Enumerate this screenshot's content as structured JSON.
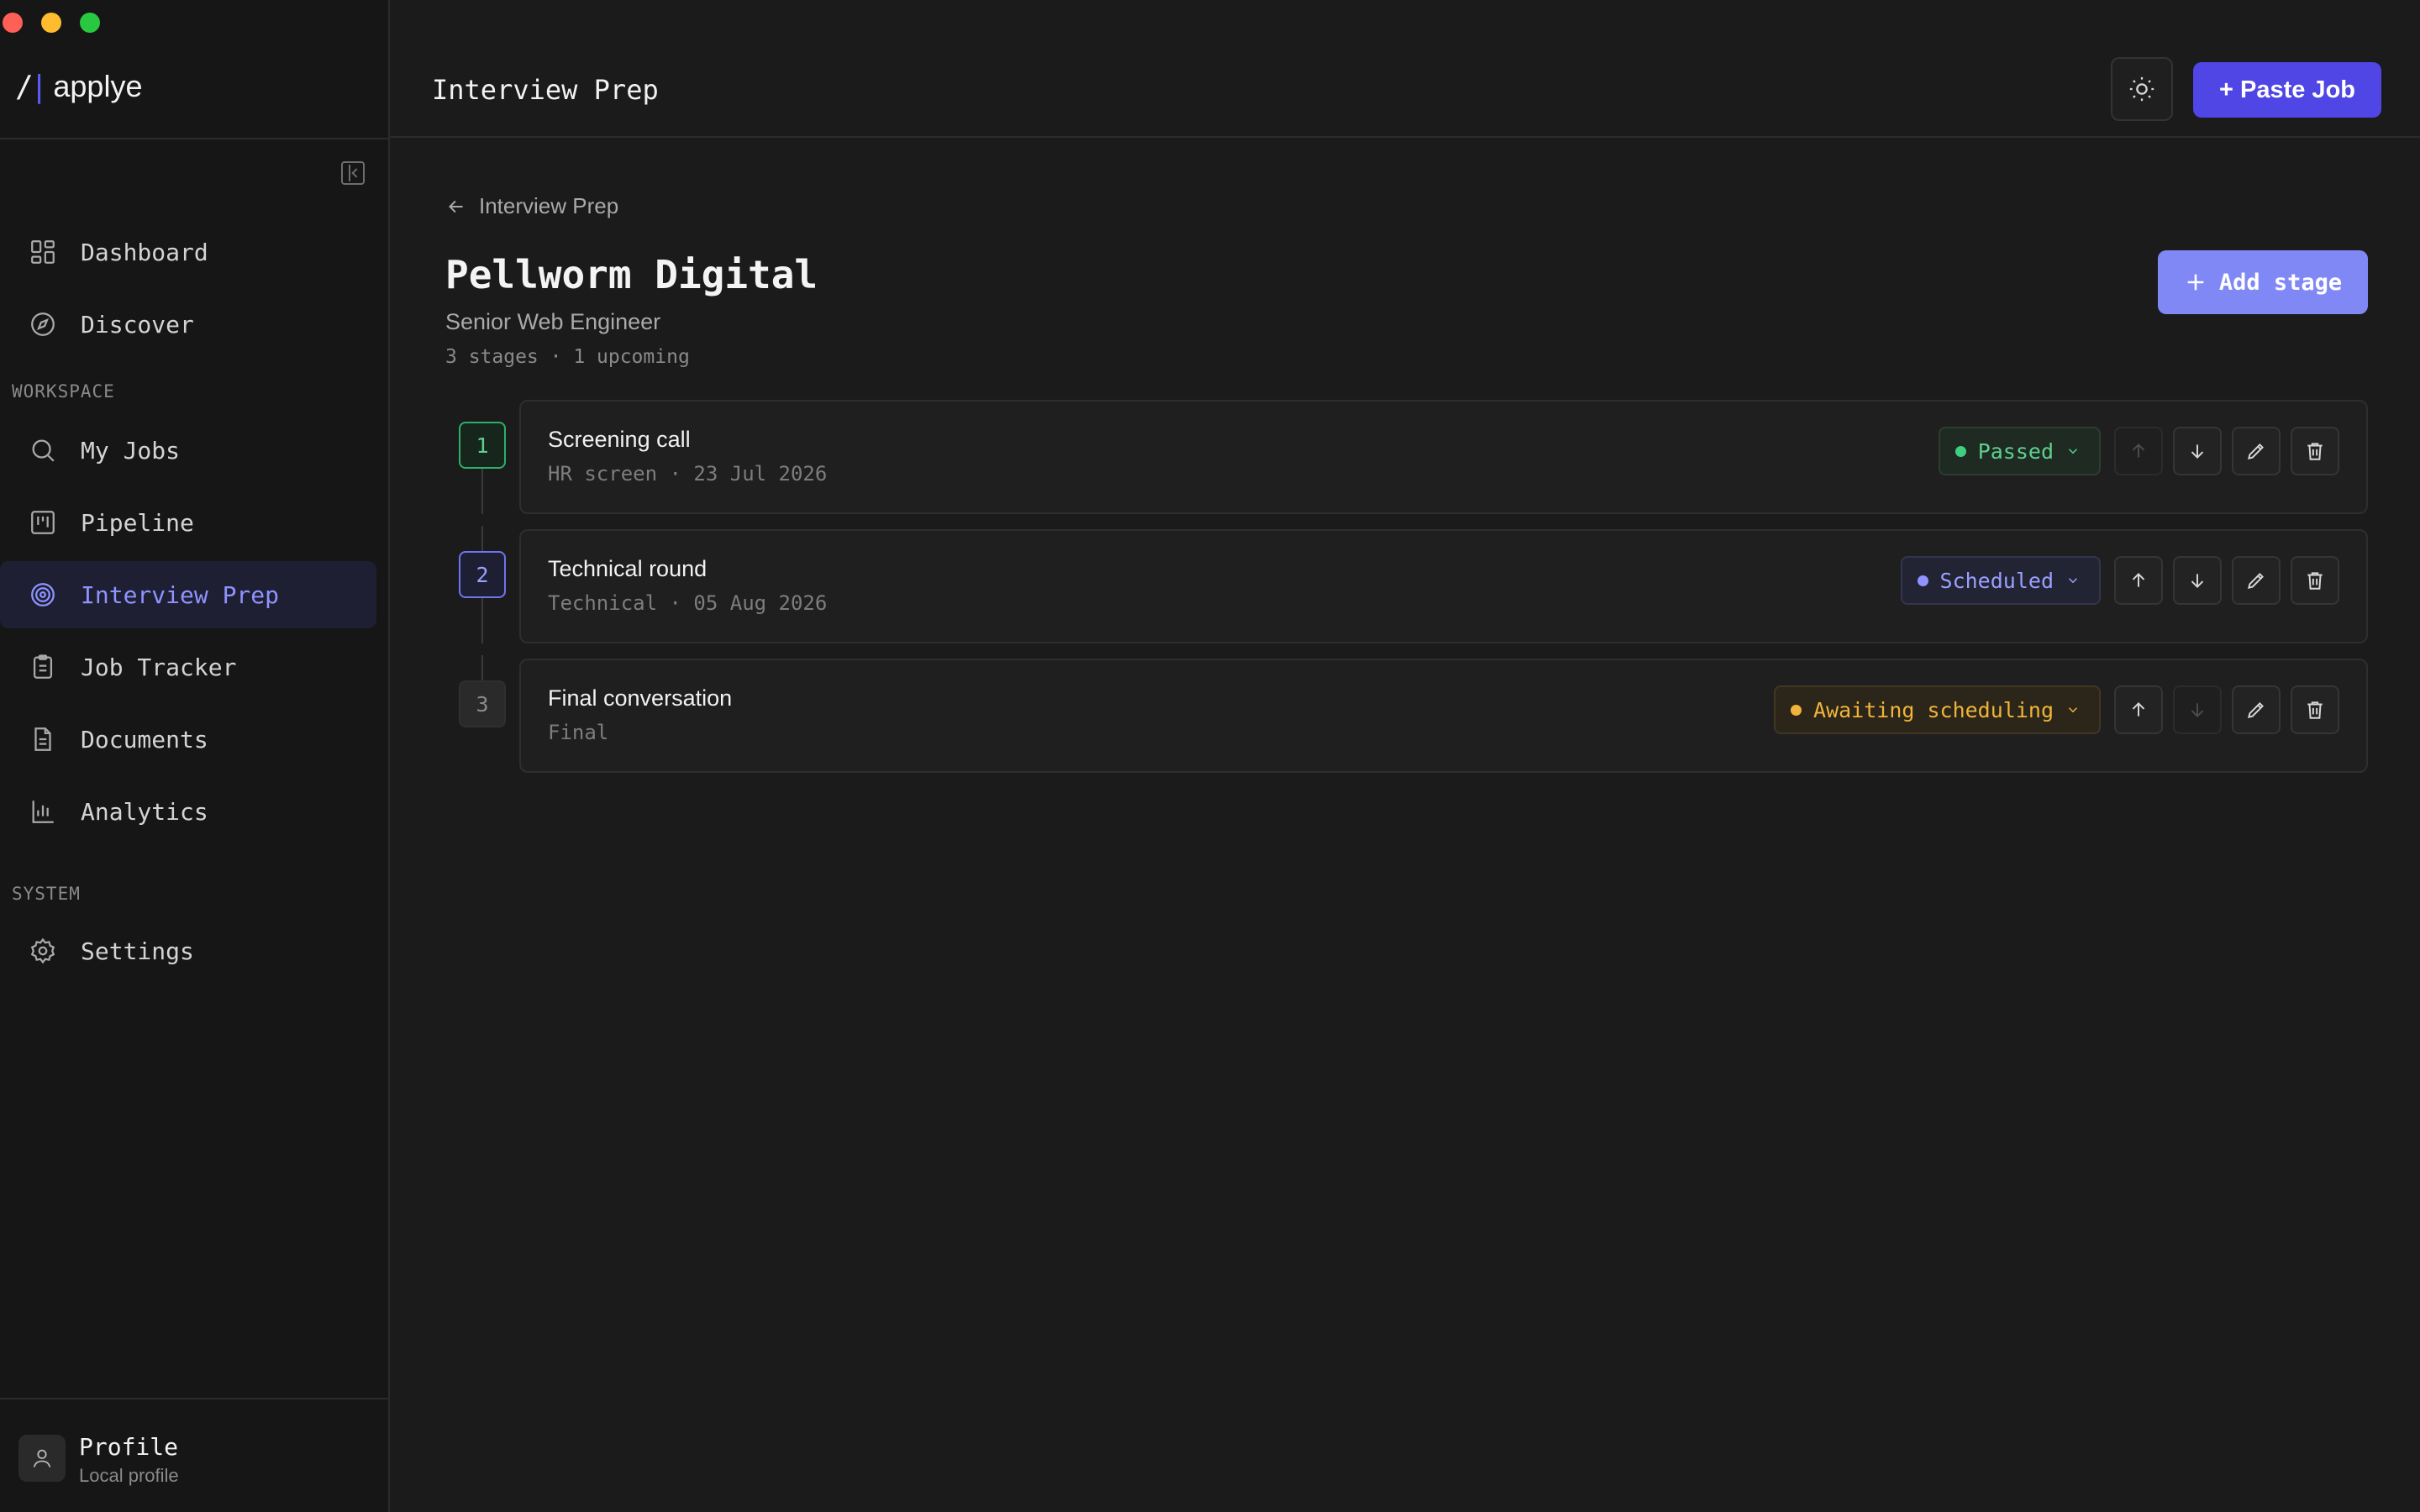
{
  "app": {
    "brand_mark": "/|",
    "brand_name": "applye"
  },
  "sidebar": {
    "items": [
      {
        "label": "Dashboard",
        "icon": "dashboard-icon"
      },
      {
        "label": "Discover",
        "icon": "compass-icon"
      },
      {
        "label": "My Jobs",
        "icon": "search-icon"
      },
      {
        "label": "Pipeline",
        "icon": "kanban-icon"
      },
      {
        "label": "Interview Prep",
        "icon": "target-icon",
        "active": true
      },
      {
        "label": "Job Tracker",
        "icon": "clipboard-icon"
      },
      {
        "label": "Documents",
        "icon": "document-icon"
      },
      {
        "label": "Analytics",
        "icon": "bar-chart-icon"
      },
      {
        "label": "Settings",
        "icon": "gear-icon"
      }
    ],
    "sections": {
      "workspace": "WORKSPACE",
      "system": "SYSTEM"
    },
    "profile": {
      "name": "Profile",
      "subtitle": "Local profile"
    }
  },
  "header": {
    "title": "Interview Prep",
    "paste_job_label": "+ Paste Job"
  },
  "main": {
    "back_label": "Interview Prep",
    "company": "Pellworm Digital",
    "role": "Senior Web Engineer",
    "meta": "3 stages · 1 upcoming",
    "add_stage_label": "Add stage",
    "stages": [
      {
        "number": "1",
        "title": "Screening call",
        "subtitle": "HR screen · 23 Jul 2026",
        "status": "Passed",
        "status_color": "#5fd08f"
      },
      {
        "number": "2",
        "title": "Technical round",
        "subtitle": "Technical · 05 Aug 2026",
        "status": "Scheduled",
        "status_color": "#9aa0ff"
      },
      {
        "number": "3",
        "title": "Final conversation",
        "subtitle": "Final",
        "status": "Awaiting scheduling",
        "status_color": "#f0b43a"
      }
    ]
  },
  "colors": {
    "accent": "#4f46e5",
    "accent_soft": "#8088f5",
    "background": "#1b1b1b",
    "sidebar_bg": "#161616"
  }
}
